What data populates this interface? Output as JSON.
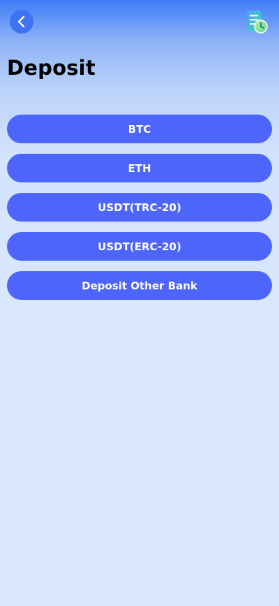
{
  "header": {
    "back_icon": "chevron-left-icon",
    "history_icon": "document-clock-icon"
  },
  "page": {
    "title": "Deposit"
  },
  "deposit_options": [
    {
      "label": "BTC"
    },
    {
      "label": "ETH"
    },
    {
      "label": "USDT(TRC-20)"
    },
    {
      "label": "USDT(ERC-20)"
    },
    {
      "label": "Deposit Other Bank"
    }
  ],
  "colors": {
    "accent": "#4d65fa",
    "back_button": "#3f73f6",
    "background": "#d9e7fd"
  }
}
